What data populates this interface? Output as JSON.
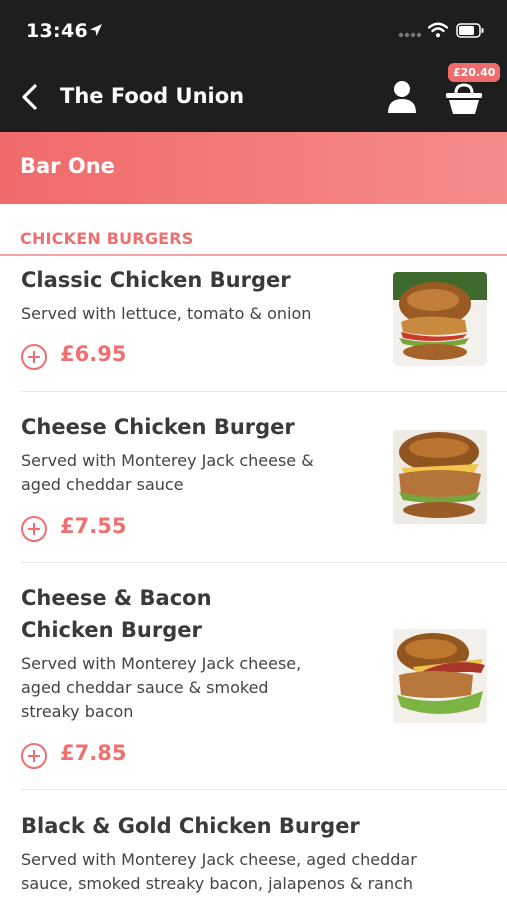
{
  "status_bar": {
    "time": "13:46"
  },
  "header": {
    "title": "The Food Union",
    "basket_total": "£20.40"
  },
  "venue": {
    "name": "Bar One"
  },
  "section": {
    "title": "CHICKEN BURGERS"
  },
  "items": [
    {
      "name": "Classic Chicken Burger",
      "description": "Served with lettuce, tomato & onion",
      "price": "£6.95"
    },
    {
      "name_line1": "Cheese Chicken Burger",
      "description_line1": "Served with Monterey Jack cheese &",
      "description_line2": "aged cheddar sauce",
      "price": "£7.55"
    },
    {
      "name_line1": "Cheese & Bacon",
      "name_line2": "Chicken Burger",
      "description_line1": "Served with Monterey Jack cheese,",
      "description_line2": "aged cheddar sauce & smoked",
      "description_line3": "streaky bacon",
      "price": "£7.85"
    },
    {
      "name": "Black & Gold Chicken Burger",
      "description_line1": "Served with Monterey Jack cheese, aged cheddar",
      "description_line2": "sauce, smoked streaky bacon, jalapenos & ranch"
    }
  ],
  "colors": {
    "accent": "#ef7070",
    "dark_bar": "#1e1e1e",
    "venue_gradient_start": "#f16a6a"
  },
  "icons": [
    "location-arrow-icon",
    "signal-dots-icon",
    "wifi-icon",
    "battery-icon",
    "back-chevron-icon",
    "user-icon",
    "basket-icon",
    "add-circle-icon"
  ]
}
